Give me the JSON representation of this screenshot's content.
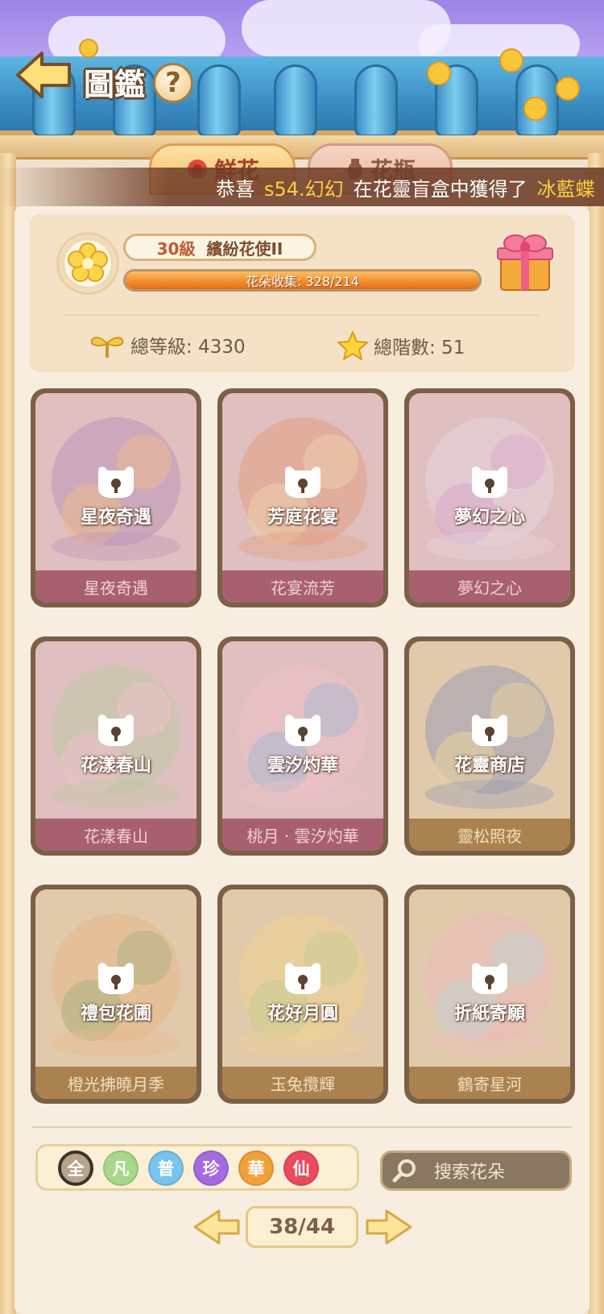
{
  "header": {
    "title": "圖鑑",
    "help_label": "?"
  },
  "tabs": [
    {
      "label": "鮮花",
      "active": true
    },
    {
      "label": "花瓶",
      "active": false
    }
  ],
  "marquee": {
    "prefix": "恭喜",
    "player": "s54.幻幻",
    "middle": "在花靈盲盒中獲得了",
    "item": "冰藍蝶"
  },
  "level_card": {
    "level": "30級",
    "rank": "繽紛花使II",
    "collection_label": "花朵收集: 328/214",
    "collection_progress": 1.0,
    "total_level_label": "總等級: 4330",
    "total_stars_label": "總階數: 51"
  },
  "cards": [
    {
      "label": "星夜奇遇",
      "footer": "星夜奇遇",
      "theme": "pink"
    },
    {
      "label": "芳庭花宴",
      "footer": "花宴流芳",
      "theme": "pink"
    },
    {
      "label": "夢幻之心",
      "footer": "夢幻之心",
      "theme": "pink"
    },
    {
      "label": "花漾春山",
      "footer": "花漾春山",
      "theme": "pink"
    },
    {
      "label": "雲汐灼華",
      "footer": "桃月 · 雲汐灼華",
      "theme": "pink"
    },
    {
      "label": "花靈商店",
      "footer": "靈松照夜",
      "theme": "gold"
    },
    {
      "label": "禮包花圃",
      "footer": "橙光拂曉月季",
      "theme": "gold"
    },
    {
      "label": "花好月圓",
      "footer": "玉兔攬輝",
      "theme": "gold"
    },
    {
      "label": "折紙寄願",
      "footer": "鶴寄星河",
      "theme": "gold"
    }
  ],
  "filters": [
    {
      "label": "全",
      "color": "#b6a48d",
      "selected": true
    },
    {
      "label": "凡",
      "color": "#a8d88a",
      "selected": false
    },
    {
      "label": "普",
      "color": "#79c3ec",
      "selected": false
    },
    {
      "label": "珍",
      "color": "#a56ae0",
      "selected": false
    },
    {
      "label": "華",
      "color": "#f3a03a",
      "selected": false
    },
    {
      "label": "仙",
      "color": "#ec4a5d",
      "selected": false
    }
  ],
  "search": {
    "placeholder": "搜索花朵"
  },
  "pager": {
    "current": "38",
    "total": "44",
    "label": "38/44"
  }
}
